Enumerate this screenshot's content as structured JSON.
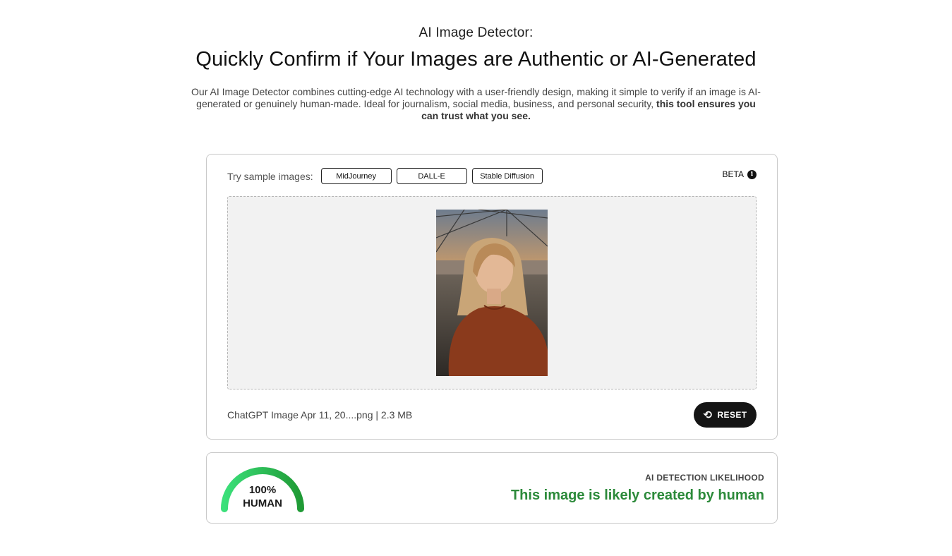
{
  "hero": {
    "eyebrow": "AI Image Detector:",
    "headline": "Quickly Confirm if Your Images are Authentic or AI-Generated",
    "lede_plain": "Our AI Image Detector combines cutting-edge AI technology with a user-friendly design, making it simple to verify if an image is AI-generated or genuinely human-made. Ideal for journalism, social media, business, and personal security, ",
    "lede_bold": "this tool ensures you can trust what you see."
  },
  "upload": {
    "sample_label": "Try sample images:",
    "samples": [
      "MidJourney",
      "DALL-E",
      "Stable Diffusion"
    ],
    "beta_label": "BETA",
    "info_icon": "info-icon",
    "file_name": "ChatGPT Image Apr 11, 20....png",
    "file_size": "2.3 MB",
    "file_separator": " | ",
    "reset_label": "RESET",
    "reset_icon": "reset-icon"
  },
  "result": {
    "gauge_percent": "100%",
    "gauge_label": "HUMAN",
    "gauge_fraction": 1.0,
    "gauge_color_start": "#3be07a",
    "gauge_color_end": "#1f9a35",
    "heading": "AI DETECTION LIKELIHOOD",
    "verdict": "This image is likely created by human",
    "verdict_color": "#2c8a3a"
  }
}
